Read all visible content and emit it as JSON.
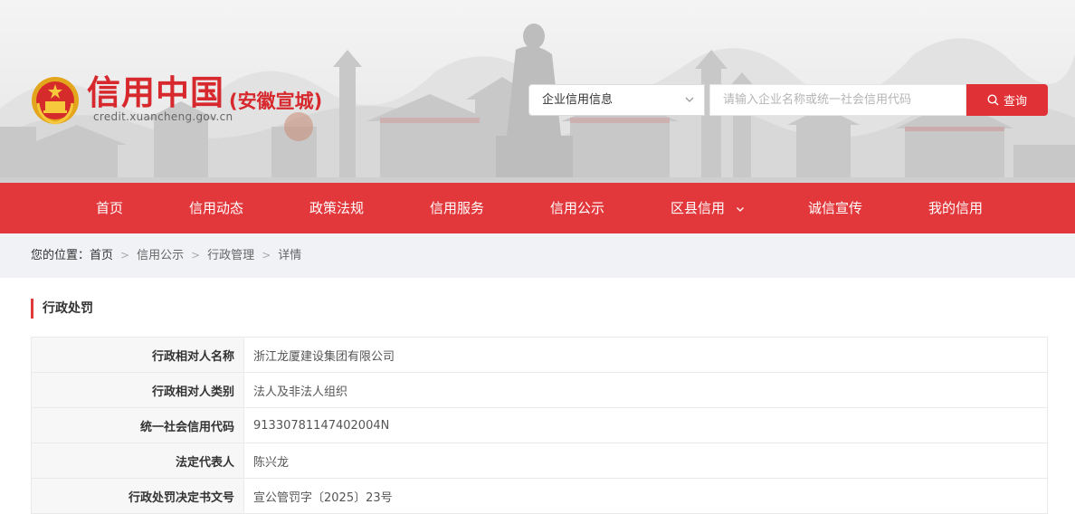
{
  "header": {
    "site_title": "信用中国",
    "site_region": "(安徽宣城)",
    "site_url": "credit.xuancheng.gov.cn",
    "emblem_icon": "national-emblem-icon"
  },
  "search": {
    "category_selected": "企业信用信息",
    "placeholder": "请输入企业名称或统一社会信用代码",
    "button_label": "查询"
  },
  "nav": {
    "items": [
      {
        "label": "首页"
      },
      {
        "label": "信用动态"
      },
      {
        "label": "政策法规"
      },
      {
        "label": "信用服务"
      },
      {
        "label": "信用公示"
      },
      {
        "label": "区县信用"
      },
      {
        "label": "诚信宣传"
      },
      {
        "label": "我的信用"
      }
    ]
  },
  "breadcrumb": {
    "prefix": "您的位置：",
    "items": [
      "首页",
      "信用公示",
      "行政管理",
      "详情"
    ],
    "separator": ">"
  },
  "section": {
    "title": "行政处罚"
  },
  "detail": {
    "rows": [
      {
        "label": "行政相对人名称",
        "value": "浙江龙厦建设集团有限公司"
      },
      {
        "label": "行政相对人类别",
        "value": "法人及非法人组织"
      },
      {
        "label": "统一社会信用代码",
        "value": "91330781147402004N"
      },
      {
        "label": "法定代表人",
        "value": "陈兴龙"
      },
      {
        "label": "行政处罚决定书文号",
        "value": "宣公管罚字〔2025〕23号"
      }
    ]
  },
  "colors": {
    "brand_red": "#e2383c",
    "title_red": "#d7282d",
    "breadcrumb_bg": "#f0f2f5"
  }
}
